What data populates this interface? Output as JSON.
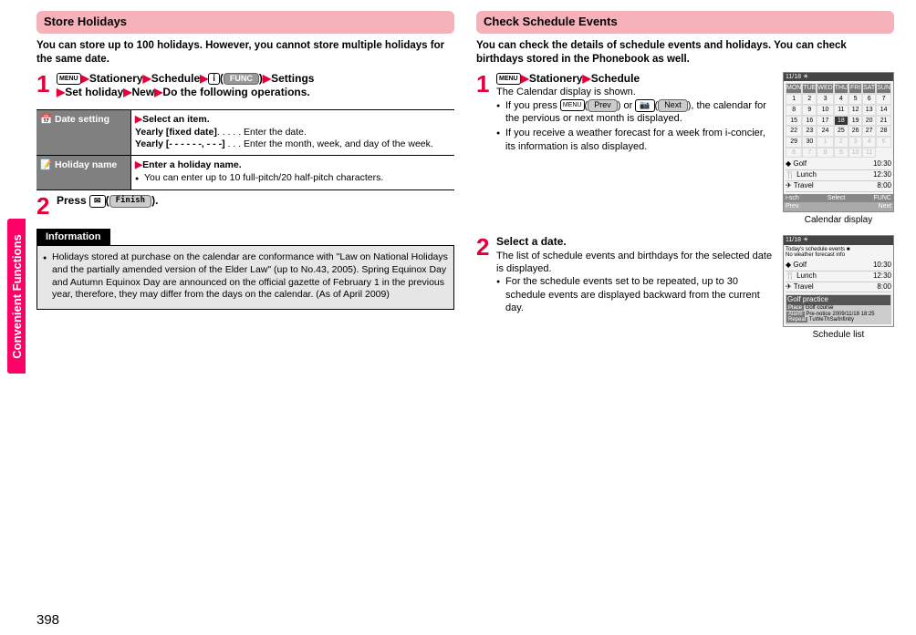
{
  "sideTab": "Convenient Functions",
  "pageNumber": "398",
  "left": {
    "header": "Store Holidays",
    "intro": "You can store up to 100 holidays. However, you cannot store multiple holidays for the same date.",
    "step1": {
      "seq": [
        "Stationery",
        "Schedule",
        "(",
        "FUNC",
        ")",
        "Settings",
        "Set holiday",
        "New",
        "Do the following operations."
      ],
      "menuAlt": "MENU"
    },
    "table": {
      "row1": {
        "label": "Date setting",
        "lead": "Select an item.",
        "l1a": "Yearly [fixed date]",
        "l1b": ". . . . . Enter the date.",
        "l2a": "Yearly [- - - - - -, - - -]",
        "l2b": " . . . Enter the month, week, and day of the week."
      },
      "row2": {
        "label": "Holiday name",
        "lead": "Enter a holiday name.",
        "note": "You can enter up to 10 full-pitch/20 half-pitch characters."
      }
    },
    "step2": {
      "pressPrefix": "Press ",
      "msgIcon": "✉",
      "finish": "Finish",
      "pressSuffix": ")."
    },
    "info": {
      "title": "Information",
      "bullet": "Holidays stored at purchase on the calendar are conformance with \"Law on National Holidays and the partially amended version of the Elder Law\" (up to No.43, 2005). Spring Equinox Day and Autumn Equinox Day are announced on the official gazette of February 1 in the previous year, therefore, they may differ from the days on the calendar. (As of April 2009)"
    }
  },
  "right": {
    "header": "Check Schedule Events",
    "intro": "You can check the details of schedule events and holidays. You can check birthdays stored in the Phonebook as well.",
    "step1": {
      "seq": [
        "Stationery",
        "Schedule"
      ],
      "desc": "The Calendar display is shown.",
      "b1a": "If you press ",
      "b1prev": "Prev",
      "b1mid": ") or ",
      "b1next": "Next",
      "b1b": "), the calendar for the pervious or next month is displayed.",
      "b2": "If you receive a weather forecast for a week from i-concier, its information is also displayed."
    },
    "calCaption": "Calendar display",
    "cal": {
      "bar": "11/18  ☀",
      "days": [
        "MON",
        "TUE",
        "WED",
        "THU",
        "FRI",
        "SAT",
        "SUN"
      ],
      "grid": [
        "1",
        "2",
        "3",
        "4",
        "5",
        "6",
        "7",
        "8",
        "9",
        "10",
        "11",
        "12",
        "13",
        "14",
        "15",
        "16",
        "17",
        "18",
        "19",
        "20",
        "21",
        "22",
        "23",
        "24",
        "25",
        "26",
        "27",
        "28",
        "29",
        "30",
        "1",
        "2",
        "3",
        "4",
        "5",
        "6",
        "7",
        "8",
        "9",
        "10",
        "11"
      ],
      "ev": [
        [
          "◆ Golf",
          "10:30"
        ],
        [
          "🍴 Lunch",
          "12:30"
        ],
        [
          "✈ Travel",
          "8:00"
        ]
      ],
      "foot": [
        "i-sch",
        "Select",
        "FUNC"
      ],
      "foot2": [
        "Prev.",
        "",
        "Next"
      ]
    },
    "step2": {
      "title": "Select a date.",
      "desc": "The list of schedule events and birthdays for the selected date is displayed.",
      "b1": "For the schedule events set to be repeated, up to 30 schedule events are displayed backward from the current day."
    },
    "listCaption": "Schedule list",
    "list": {
      "bar": "11/18 ☀",
      "sub1": "Today's schedule events ■",
      "sub2": "No weather forecast info",
      "ev": [
        [
          "◆ Golf",
          "10:30"
        ],
        [
          "🍴 Lunch",
          "12:30"
        ],
        [
          "✈ Travel",
          "8:00"
        ]
      ],
      "detail": {
        "title": "Golf practice",
        "place": "Golf course",
        "alarm": "Pre-notice 2009/11/18 18:25",
        "repeat": "TuWeThSa/Infinity"
      },
      "labels": {
        "place": "Place",
        "alarm": "Alarm",
        "repeat": "Repeat"
      }
    }
  }
}
